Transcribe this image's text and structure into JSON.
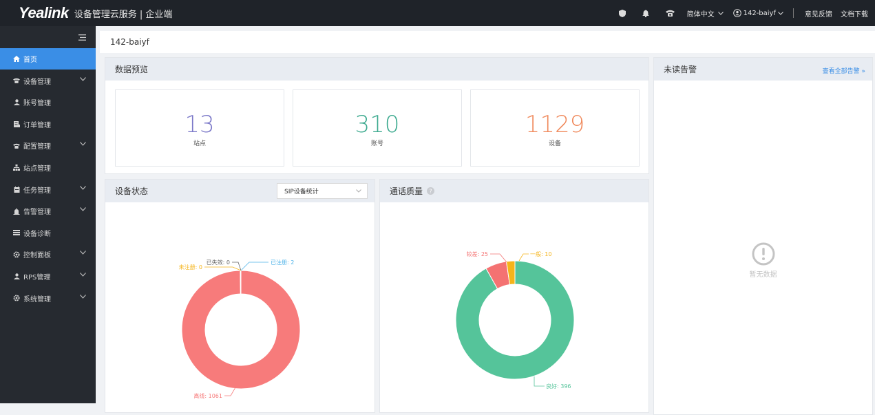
{
  "header": {
    "logo": "Yealink",
    "app_title": "设备管理云服务 | 企业端",
    "language": "简体中文",
    "user": "142-baiyf",
    "feedback": "意见反馈",
    "docs": "文档下载"
  },
  "sidebar": {
    "items": [
      {
        "label": "首页",
        "icon": "home-icon",
        "expandable": false,
        "active": true
      },
      {
        "label": "设备管理",
        "icon": "phone-icon",
        "expandable": true
      },
      {
        "label": "账号管理",
        "icon": "user-icon",
        "expandable": false
      },
      {
        "label": "订单管理",
        "icon": "order-icon",
        "expandable": false
      },
      {
        "label": "配置管理",
        "icon": "phone-icon",
        "expandable": true
      },
      {
        "label": "站点管理",
        "icon": "site-icon",
        "expandable": false
      },
      {
        "label": "任务管理",
        "icon": "task-icon",
        "expandable": true
      },
      {
        "label": "告警管理",
        "icon": "alarm-icon",
        "expandable": true
      },
      {
        "label": "设备诊断",
        "icon": "diagnose-icon",
        "expandable": false
      },
      {
        "label": "控制面板",
        "icon": "gear-icon",
        "expandable": true
      },
      {
        "label": "RPS管理",
        "icon": "user-icon",
        "expandable": true
      },
      {
        "label": "系统管理",
        "icon": "gear-icon",
        "expandable": true
      }
    ]
  },
  "breadcrumb": "142-baiyf",
  "overview": {
    "title": "数据预览",
    "stats": [
      {
        "value": "13",
        "label": "站点",
        "color": "#7b78c8"
      },
      {
        "value": "310",
        "label": "账号",
        "color": "#3daa8f"
      },
      {
        "value": "1129",
        "label": "设备",
        "color": "#f08a5d"
      }
    ]
  },
  "device_status": {
    "title": "设备状态",
    "select_value": "SIP设备统计",
    "chart_data": {
      "type": "pie",
      "donut": true,
      "slices": [
        {
          "name": "离线",
          "value": 1061,
          "color": "#f77b7b",
          "label": "离线: 1061"
        },
        {
          "name": "已注册",
          "value": 2,
          "color": "#4fb3e8",
          "label": "已注册: 2"
        },
        {
          "name": "已失效",
          "value": 0,
          "color": "#666666",
          "label": "已失效: 0"
        },
        {
          "name": "未注册",
          "value": 0,
          "color": "#f5b41a",
          "label": "未注册: 0"
        }
      ]
    }
  },
  "call_quality": {
    "title": "通话质量",
    "chart_data": {
      "type": "pie",
      "donut": true,
      "slices": [
        {
          "name": "良好",
          "value": 396,
          "color": "#55c49a",
          "label": "良好: 396"
        },
        {
          "name": "较差",
          "value": 25,
          "color": "#f47272",
          "label": "较差: 25"
        },
        {
          "name": "一般",
          "value": 10,
          "color": "#f5b41a",
          "label": "一般: 10"
        }
      ]
    }
  },
  "alerts": {
    "title": "未读告警",
    "view_all": "查看全部告警 »",
    "empty": "暂无数据"
  }
}
